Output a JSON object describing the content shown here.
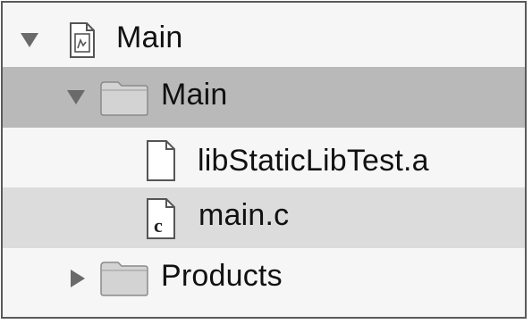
{
  "navigator": {
    "items": [
      {
        "label": "Main",
        "kind": "project",
        "icon": "project-file-icon",
        "expanded": true
      },
      {
        "label": "Main",
        "kind": "group",
        "icon": "folder-icon",
        "expanded": true,
        "selected": true
      },
      {
        "label": "libStaticLibTest.a",
        "kind": "file",
        "icon": "blank-file-icon"
      },
      {
        "label": "main.c",
        "kind": "file",
        "icon": "c-source-file-icon",
        "file_badge": "c"
      },
      {
        "label": "Products",
        "kind": "group",
        "icon": "folder-icon",
        "expanded": false
      }
    ]
  },
  "colors": {
    "selected_row": "#b9b9b9",
    "hover_row": "#dcdcdc",
    "background": "#f6f6f6",
    "border": "#5a5a5a"
  }
}
